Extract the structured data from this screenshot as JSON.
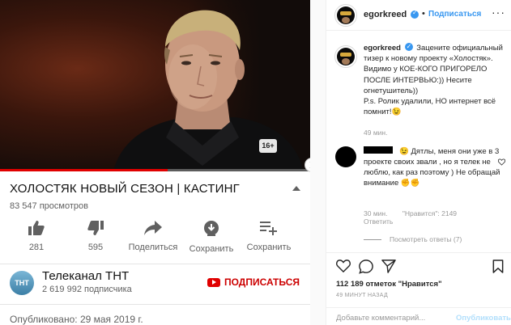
{
  "youtube": {
    "video_badge": "16+",
    "progress_fraction": 0.54,
    "title": "ХОЛОСТЯК НОВЫЙ СЕЗОН | КАСТИНГ",
    "views": "83 547 просмотров",
    "actions": {
      "likes": "281",
      "dislikes": "595",
      "share": "Поделиться",
      "download": "Сохранить",
      "save": "Сохранить"
    },
    "channel": {
      "avatar_text": "ТНТ",
      "name": "Телеканал ТНТ",
      "subscribers": "2 619 992 подписчика",
      "subscribe_label": "ПОДПИСАТЬСЯ"
    },
    "published": "Опубликовано: 29 мая 2019 г."
  },
  "instagram": {
    "header": {
      "username": "egorkreed",
      "separator": "•",
      "follow_label": "Подписаться",
      "more": "···"
    },
    "caption": {
      "username": "egorkreed",
      "text": "Зацените официальный тизер к новому проекту «Холостяк». Видимо у КОЕ-КОГО ПРИГОРЕЛО ПОСЛЕ ИНТЕРВЬЮ:)) Несите огнетушитель))\nP.s. Ролик удалили, НО интернет всё помнит!😉",
      "time": "49 мин."
    },
    "comment": {
      "text": "😉 Дятлы, меня они уже в 3 проекте своих звали , но я телек не люблю, как раз поэтому ) Не обращай внимание ✊✊",
      "time": "30 мин.",
      "likes": "\"Нравится\": 2149",
      "reply": "Ответить",
      "view_replies": "Посмотреть ответы (7)"
    },
    "likes": "112 189 отметок \"Нравится\"",
    "post_time": "49 МИНУТ НАЗАД",
    "add_comment": {
      "placeholder": "Добавьте комментарий...",
      "publish": "Опубликовать"
    },
    "colors": {
      "link_blue": "#3897f0",
      "muted": "#999999",
      "youtube_red": "#cc0000"
    }
  }
}
